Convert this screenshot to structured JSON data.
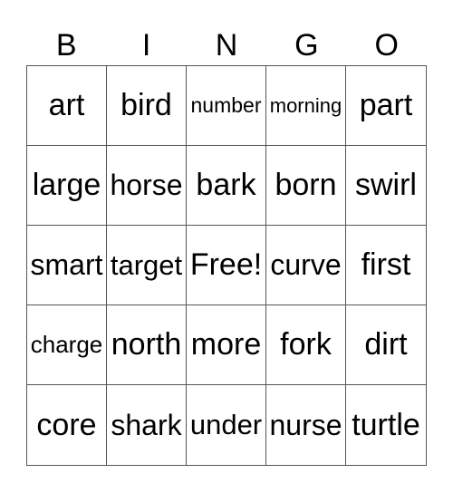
{
  "header": [
    "B",
    "I",
    "N",
    "G",
    "O"
  ],
  "cells": [
    [
      "art",
      "bird",
      "number",
      "morning",
      "part"
    ],
    [
      "large",
      "horse",
      "bark",
      "born",
      "swirl"
    ],
    [
      "smart",
      "target",
      "Free!",
      "curve",
      "first"
    ],
    [
      "charge",
      "north",
      "more",
      "fork",
      "dirt"
    ],
    [
      "core",
      "shark",
      "under",
      "nurse",
      "turtle"
    ]
  ]
}
